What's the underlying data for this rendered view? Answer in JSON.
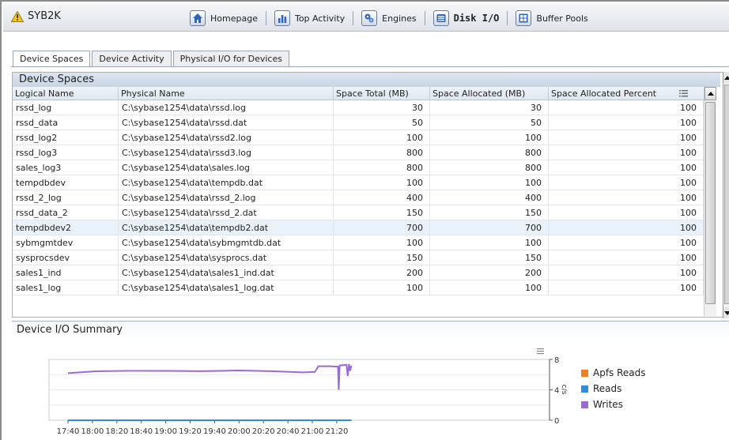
{
  "server": {
    "name": "SYB2K",
    "icon": "warning-icon"
  },
  "nav": [
    {
      "label": "Homepage",
      "icon": "home-icon"
    },
    {
      "label": "Top Activity",
      "icon": "bar-chart-icon"
    },
    {
      "label": "Engines",
      "icon": "engine-icon"
    },
    {
      "label": "Disk I/O",
      "icon": "disk-icon",
      "active": true
    },
    {
      "label": "Buffer Pools",
      "icon": "buffer-pools-icon"
    }
  ],
  "tabs": [
    {
      "label": "Device Spaces",
      "active": true
    },
    {
      "label": "Device Activity"
    },
    {
      "label": "Physical I/O for Devices"
    }
  ],
  "device_spaces": {
    "title": "Device Spaces",
    "columns": [
      "Logical Name",
      "Physical Name",
      "Space Total (MB)",
      "Space Allocated (MB)",
      "Space Allocated Percent"
    ],
    "rows": [
      [
        "rssd_log",
        "C:\\sybase1254\\data\\rssd.log",
        "30",
        "30",
        "100"
      ],
      [
        "rssd_data",
        "C:\\sybase1254\\data\\rssd.dat",
        "50",
        "50",
        "100"
      ],
      [
        "rssd_log2",
        "C:\\sybase1254\\data\\rssd2.log",
        "100",
        "100",
        "100"
      ],
      [
        "rssd_log3",
        "C:\\sybase1254\\data\\rssd3.log",
        "800",
        "800",
        "100"
      ],
      [
        "sales_log3",
        "C:\\sybase1254\\data\\sales.log",
        "800",
        "800",
        "100"
      ],
      [
        "tempdbdev",
        "C:\\sybase1254\\data\\tempdb.dat",
        "100",
        "100",
        "100"
      ],
      [
        "rssd_2_log",
        "C:\\sybase1254\\data\\rssd_2.log",
        "400",
        "400",
        "100"
      ],
      [
        "rssd_data_2",
        "C:\\sybase1254\\data\\rssd_2.dat",
        "150",
        "150",
        "100"
      ],
      [
        "tempdbdev2",
        "C:\\sybase1254\\data\\tempdb2.dat",
        "700",
        "700",
        "100"
      ],
      [
        "sybmgmtdev",
        "C:\\sybase1254\\data\\sybmgmtdb.dat",
        "100",
        "100",
        "100"
      ],
      [
        "sysprocsdev",
        "C:\\sybase1254\\data\\sysprocs.dat",
        "150",
        "150",
        "100"
      ],
      [
        "sales1_ind",
        "C:\\sybase1254\\data\\sales1_ind.dat",
        "200",
        "200",
        "100"
      ],
      [
        "sales1_log",
        "C:\\sybase1254\\data\\sales1_log.dat",
        "100",
        "100",
        "100"
      ]
    ],
    "selected_row": 8
  },
  "summary": {
    "title": "Device I/O Summary",
    "x_ticks": [
      "17:40",
      "18:00",
      "18:20",
      "18:40",
      "19:00",
      "19:20",
      "19:40",
      "20:00",
      "20:20",
      "20:40",
      "21:00",
      "21:20"
    ],
    "y_ticks": [
      "0",
      "4",
      "8"
    ],
    "y_label": "c/s",
    "ymax": 8,
    "series": [
      {
        "name": "Apfs Reads",
        "color": "#f07f1e",
        "values": [
          [
            0,
            0
          ],
          [
            11.6,
            0
          ]
        ]
      },
      {
        "name": "Reads",
        "color": "#2f8ee0",
        "values": [
          [
            0,
            0
          ],
          [
            11.6,
            0
          ]
        ]
      },
      {
        "name": "Writes",
        "color": "#9a6bd1",
        "values": [
          [
            0,
            6.2
          ],
          [
            1.2,
            6.45
          ],
          [
            2.5,
            6.5
          ],
          [
            4,
            6.5
          ],
          [
            5.5,
            6.45
          ],
          [
            7,
            6.55
          ],
          [
            8.3,
            6.45
          ],
          [
            9.6,
            6.3
          ],
          [
            10.1,
            6.35
          ],
          [
            10.25,
            7.1
          ],
          [
            10.7,
            7.1
          ],
          [
            11.05,
            7.05
          ],
          [
            11.08,
            4.0
          ],
          [
            11.12,
            7.2
          ],
          [
            11.4,
            7.3
          ],
          [
            11.45,
            5.8
          ],
          [
            11.5,
            7.4
          ],
          [
            11.55,
            6.5
          ],
          [
            11.6,
            7.2
          ]
        ]
      }
    ]
  }
}
